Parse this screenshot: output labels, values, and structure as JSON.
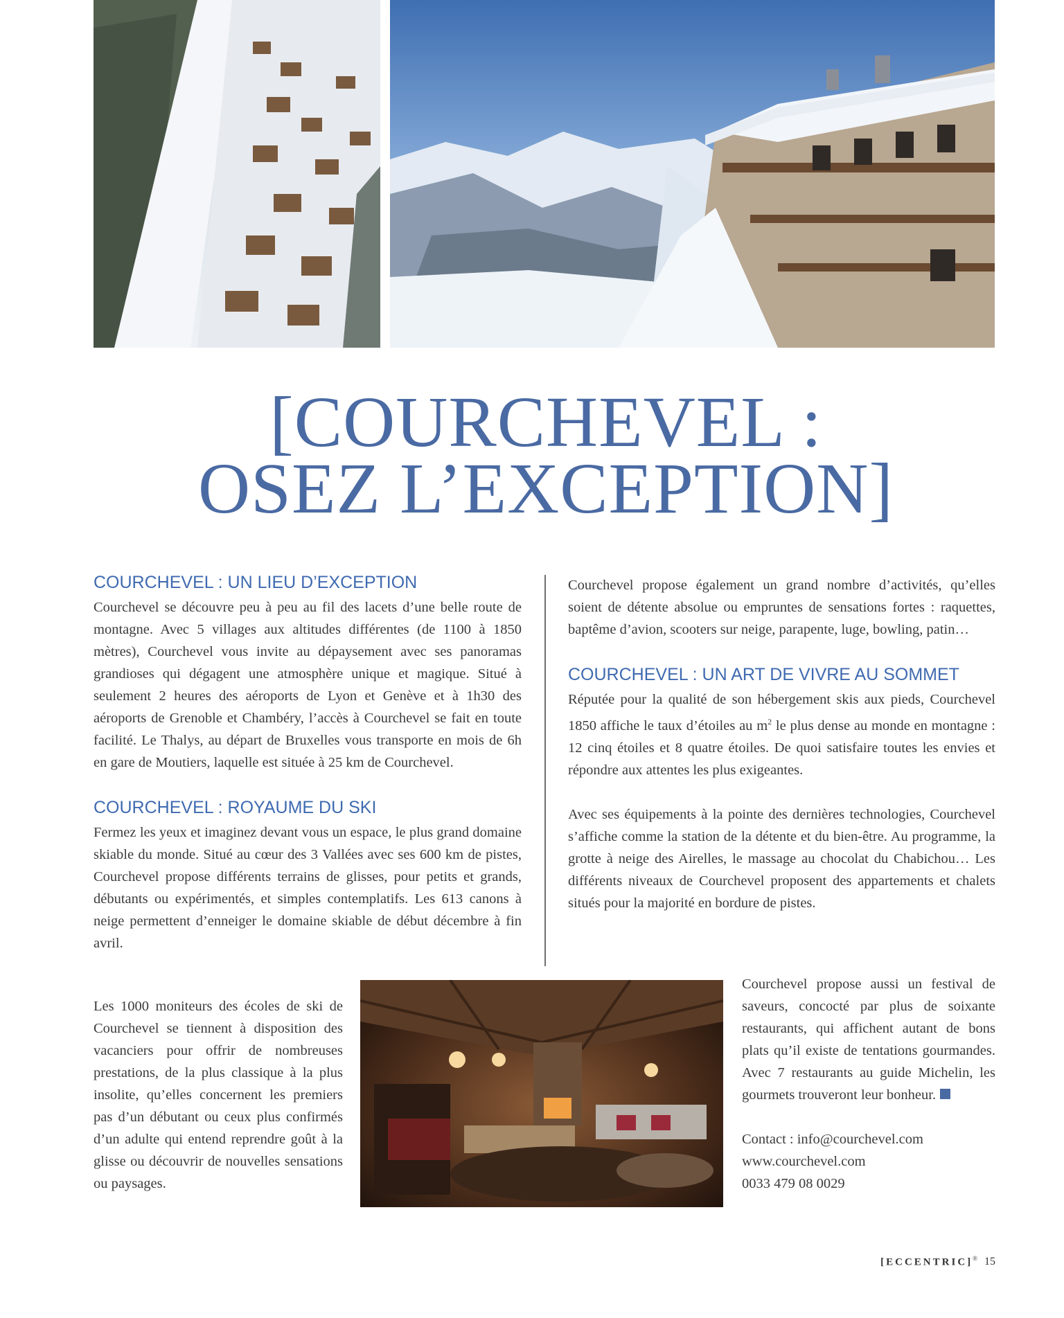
{
  "title": {
    "line1": "[COURCHEVEL :",
    "line2": "OSEZ L’EXCEPTION]"
  },
  "left_column": {
    "section1": {
      "heading": "COURCHEVEL : UN LIEU D’EXCEPTION",
      "body": "Courchevel se découvre peu à peu au fil des lacets d’une belle route de montagne. Avec 5 villages aux altitudes différentes (de 1100 à 1850 mètres), Courchevel vous invite au dépaysement avec ses panoramas grandioses qui dégagent une atmosphère unique et magique. Situé à seulement 2 heures des aéroports de Lyon et Genève et à 1h30 des aéroports de Grenoble et Chambéry, l’accès à Courchevel se fait en toute facilité. Le Thalys, au départ de Bruxelles vous transporte en mois de 6h en gare de Moutiers, laquelle est située à 25 km de Courchevel."
    },
    "section2": {
      "heading": "COURCHEVEL : ROYAUME DU SKI",
      "body": "Fermez les yeux et imaginez devant vous un espace, le plus grand domaine skiable du monde. Situé au cœur des 3 Vallées avec ses 600 km de pistes, Courchevel propose différents terrains de glisses, pour petits et grands, débutants ou expérimentés, et simples contemplatifs. Les 613 canons à neige permettent d’enneiger le domaine skiable de début décembre à fin avril."
    },
    "bottom_paragraph": "Les 1000 moniteurs des écoles de ski de Courchevel se tiennent à disposition des vacanciers pour offrir de nombreuses prestations, de la plus classique à la plus insolite, qu’elles concernent les premiers pas d’un débutant ou ceux plus confirmés d’un adulte qui entend reprendre goût à la glisse ou découvrir de nouvelles sensations ou paysages."
  },
  "right_column": {
    "intro": "Courchevel propose également un grand nombre d’activités, qu’elles soient de détente absolue ou empruntes de sensations fortes : raquettes, baptême d’avion, scooters sur neige, parapente, luge, bowling, patin…",
    "section3": {
      "heading": "COURCHEVEL : UN ART DE VIVRE AU SOMMET",
      "body_before_unit": "Réputée pour la qualité de son hébergement skis aux pieds, Courchevel 1850 affiche le taux d’étoiles au ",
      "unit": "m",
      "unit_sup": "2",
      "body_after_unit": " le plus dense au monde en montagne : 12 cinq étoiles et 8 quatre étoiles. De quoi satisfaire toutes les envies et répondre aux attentes les plus exigeantes.",
      "body2": "Avec ses équipements à la pointe des dernières technologies, Courchevel s’affiche comme la station de la détente et du bien-être. Au programme, la grotte à neige des Airelles, le massage au chocolat du Chabichou… Les différents niveaux de Courchevel proposent des appartements et chalets situés pour la majorité en bordure de pistes."
    },
    "bottom_paragraph": "Courchevel propose aussi un festival de saveurs, concocté par plus de soixante restaurants, qui affichent autant de bons plats qu’il existe de tentations gourmandes. Avec 7 restaurants au guide Michelin, les gourmets trouveront leur bonheur.",
    "contact": {
      "email_line": "Contact : info@courchevel.com",
      "website": "www.courchevel.com",
      "phone": "0033 479 08 0029"
    }
  },
  "footer": {
    "brand": "[ECCENTRIC]",
    "brand_mark": "®",
    "page_number": "15"
  },
  "colors": {
    "accent_blue": "#4a6aa3",
    "heading_blue": "#3f6ab0",
    "body_text": "#3b3b3b"
  }
}
